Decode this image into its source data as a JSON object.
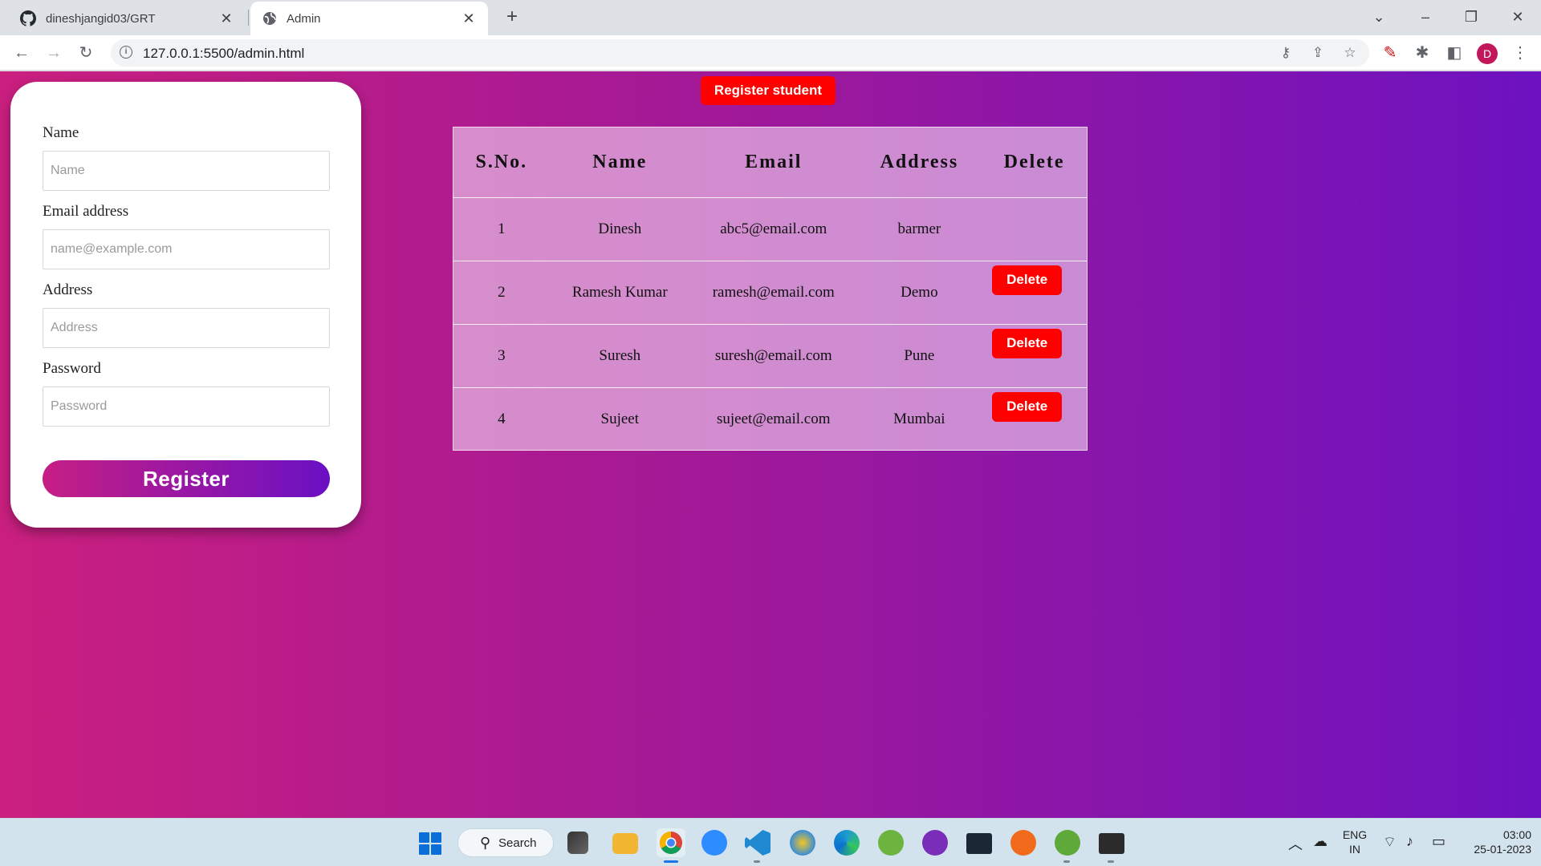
{
  "browser": {
    "tabs": [
      {
        "title": "dineshjangid03/GRT",
        "icon": "github-icon"
      },
      {
        "title": "Admin",
        "icon": "globe-icon"
      }
    ],
    "url": "127.0.0.1:5500/admin.html",
    "profile_initial": "D"
  },
  "page": {
    "register_student_label": "Register student",
    "form": {
      "name_label": "Name",
      "name_placeholder": "Name",
      "email_label": "Email address",
      "email_placeholder": "name@example.com",
      "address_label": "Address",
      "address_placeholder": "Address",
      "password_label": "Password",
      "password_placeholder": "Password",
      "submit_label": "Register"
    },
    "table": {
      "headers": [
        "S.No.",
        "Name",
        "Email",
        "Address",
        "Delete"
      ],
      "rows": [
        {
          "sno": "1",
          "name": "Dinesh",
          "email": "abc5@email.com",
          "address": "barmer",
          "delete": ""
        },
        {
          "sno": "2",
          "name": "Ramesh Kumar",
          "email": "ramesh@email.com",
          "address": "Demo",
          "delete": "Delete"
        },
        {
          "sno": "3",
          "name": "Suresh",
          "email": "suresh@email.com",
          "address": "Pune",
          "delete": "Delete"
        },
        {
          "sno": "4",
          "name": "Sujeet",
          "email": "sujeet@email.com",
          "address": "Mumbai",
          "delete": "Delete"
        }
      ]
    },
    "colors": {
      "accent_red": "#ff0000",
      "gradient_start": "#ca1f7f",
      "gradient_end": "#6d12c0"
    }
  },
  "taskbar": {
    "search_label": "Search",
    "language": "ENG",
    "region": "IN",
    "time": "03:00",
    "date": "25-01-2023"
  }
}
